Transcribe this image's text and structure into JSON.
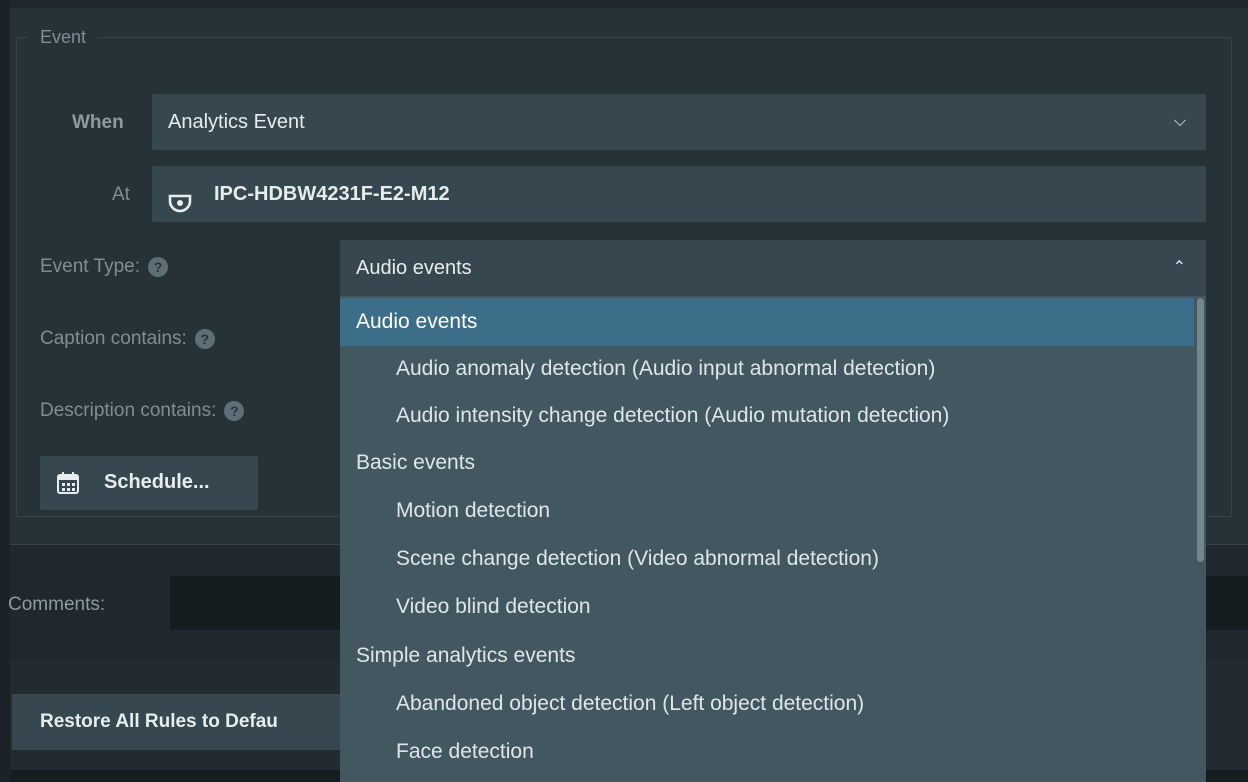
{
  "event_group": {
    "title": "Event",
    "when_label": "When",
    "when_value": "Analytics Event",
    "at_label": "At",
    "at_value": "IPC-HDBW4231F-E2-M12",
    "event_type_label": "Event Type:",
    "event_type_value": "Audio events",
    "caption_label": "Caption contains:",
    "description_label": "Description contains:",
    "schedule_button": "Schedule...",
    "help_glyph": "?"
  },
  "comments_label": "Comments:",
  "restore_button": "Restore All Rules to Defau",
  "dropdown": {
    "items": [
      {
        "label": "Audio events",
        "level": "group",
        "selected": true
      },
      {
        "label": "Audio anomaly detection (Audio input abnormal detection)",
        "level": "child"
      },
      {
        "label": "Audio intensity change detection (Audio mutation detection)",
        "level": "child"
      },
      {
        "label": "Basic events",
        "level": "group"
      },
      {
        "label": "Motion detection",
        "level": "child"
      },
      {
        "label": "Scene change detection (Video abnormal detection)",
        "level": "child"
      },
      {
        "label": "Video blind detection",
        "level": "child"
      },
      {
        "label": "Simple analytics events",
        "level": "group"
      },
      {
        "label": "Abandoned object detection (Left object detection)",
        "level": "child"
      },
      {
        "label": "Face detection",
        "level": "child"
      }
    ]
  },
  "icons": {
    "when_chevron": "chevron-down-icon",
    "event_type_chevron": "chevron-up-icon",
    "camera": "dome-camera-icon",
    "calendar": "calendar-icon"
  },
  "colors": {
    "background": "#1f282e",
    "panel": "#263238",
    "field": "#37474f",
    "dropdown": "#435761",
    "selection": "#3c6e8a"
  }
}
